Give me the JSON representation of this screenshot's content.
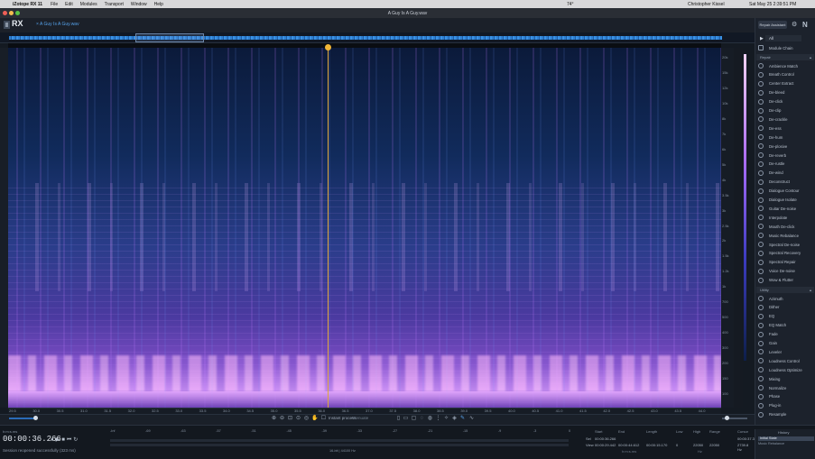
{
  "menubar": {
    "app": "iZotope RX 11",
    "items": [
      "File",
      "Edit",
      "Modules",
      "Transport",
      "Window",
      "Help"
    ],
    "user": "Christopher Kissel",
    "clock": "Sat May 25  2:39:51 PM",
    "weather": "74°"
  },
  "window": {
    "title": "A Guy Is A Guy.wav"
  },
  "logo": {
    "name": "RX"
  },
  "tab": {
    "file": "A Guy Is A Guy.wav"
  },
  "repair_assistant": "Repair Assistant",
  "modules": {
    "filter": "All",
    "chain": "Module Chain",
    "repair_label": "Repair",
    "repair": [
      "Ambience Match",
      "Breath Control",
      "Center Extract",
      "De-bleed",
      "De-click",
      "De-clip",
      "De-crackle",
      "De-ess",
      "De-hum",
      "De-plosive",
      "De-reverb",
      "De-rustle",
      "De-wind",
      "Deconstruct",
      "Dialogue Contour",
      "Dialogue Isolate",
      "Guitar De-noise",
      "Interpolate",
      "Mouth De-click",
      "Music Rebalance",
      "Spectral De-noise",
      "Spectral Recovery",
      "Spectral Repair",
      "Voice De-noise",
      "Wow & Flutter"
    ],
    "utility_label": "Utility",
    "utility": [
      "Azimuth",
      "Dither",
      "EQ",
      "EQ Match",
      "Fade",
      "Gain",
      "Leveler",
      "Loudness Control",
      "Loudness Optimize",
      "Mixing",
      "Normalize",
      "Phase",
      "Plug-in",
      "Resample"
    ]
  },
  "time_ticks": [
    "29.5",
    "30.0",
    "30.5",
    "31.0",
    "31.5",
    "32.0",
    "32.5",
    "33.0",
    "33.5",
    "34.0",
    "34.5",
    "35.0",
    "35.5",
    "36.0",
    "36.5",
    "37.0",
    "37.5",
    "38.0",
    "38.5",
    "39.0",
    "39.5",
    "40.0",
    "40.5",
    "41.0",
    "41.5",
    "42.0",
    "42.5",
    "43.0",
    "43.5",
    "44.0"
  ],
  "freq_ticks": [
    "20k",
    "15k",
    "12k",
    "10k",
    "8k",
    "7k",
    "6k",
    "5k",
    "4k",
    "3.5k",
    "3k",
    "2.5k",
    "2k",
    "1.5k",
    "1.2k",
    "1k",
    "700",
    "500",
    "400",
    "300",
    "200",
    "150",
    "100"
  ],
  "toolbar": {
    "instant": "Instant process",
    "attenuate": "Attenuate"
  },
  "bottom": {
    "tc_label": "h:m:s.ms",
    "timecode": "00:00:36.266",
    "status": "Session reopened successfully (323 ms)",
    "format": "16-bit | 44100 Hz",
    "meter_ticks": [
      "-Inf",
      "-69",
      "-63",
      "-57",
      "-51",
      "-45",
      "-39",
      "-33",
      "-27",
      "-21",
      "-15",
      "-9",
      "-3",
      "0"
    ]
  },
  "selection": {
    "headers": [
      "Start",
      "End",
      "Length",
      "Low",
      "High",
      "Range",
      "Cursor"
    ],
    "sel_label": "Sel",
    "view_label": "View",
    "sel": [
      "00:00:36.266",
      "",
      "",
      "",
      "",
      "",
      ""
    ],
    "view": [
      "00:00:29.442",
      "00:00:44.612",
      "00:00:15.170",
      "0",
      "22050",
      "22050",
      "2739.8 Hz"
    ],
    "cursor_time": "00:00:37.337",
    "unit_ms": "h:m:s.ms",
    "unit_hz": "Hz"
  },
  "history": {
    "title": "History",
    "items": [
      "Initial State",
      "Music Rebalance"
    ]
  }
}
